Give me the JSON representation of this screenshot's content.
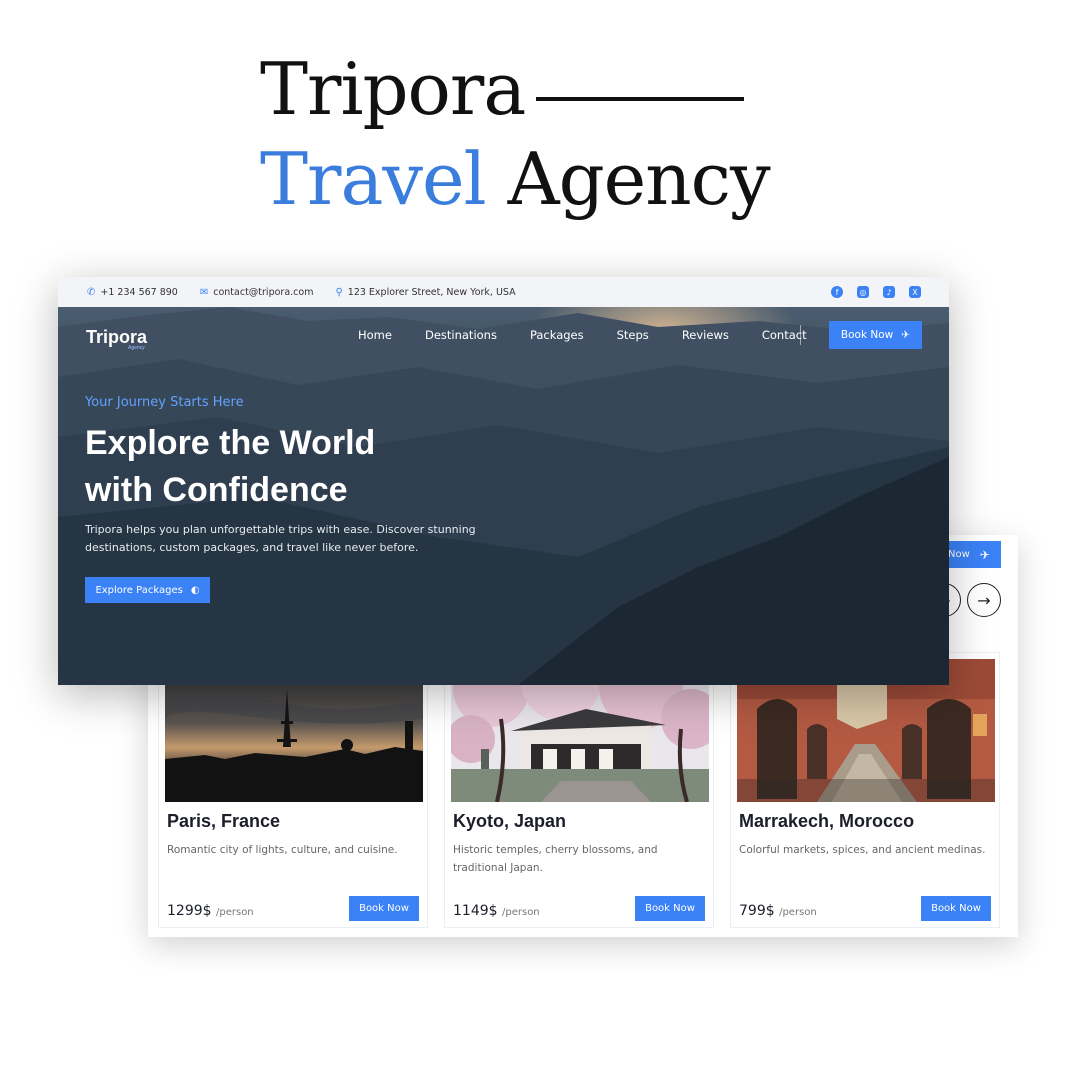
{
  "poster": {
    "title_line1": "Tripora",
    "title_word_accent": "Travel",
    "title_word_rest": "Agency"
  },
  "topbar": {
    "phone": "+1 234 567 890",
    "email": "contact@tripora.com",
    "address": "123 Explorer Street, New York, USA",
    "socials": [
      "facebook-icon",
      "instagram-icon",
      "tiktok-icon",
      "x-icon"
    ]
  },
  "nav": {
    "logo": "Tripora",
    "logo_sub": "Agency",
    "items": [
      "Home",
      "Destinations",
      "Packages",
      "Steps",
      "Reviews",
      "Contact"
    ],
    "book_label": "Book Now"
  },
  "hero": {
    "tagline": "Your Journey Starts Here",
    "headline_line1": "Explore the World",
    "headline_line2": "with Confidence",
    "lead": "Tripora helps you plan unforgettable trips with ease. Discover stunning destinations, custom packages, and travel like never before.",
    "cta": "Explore Packages"
  },
  "destinations_header": {
    "book_label_partial": "Now"
  },
  "destinations": [
    {
      "city": "Paris, France",
      "desc": "Romantic city of lights, culture, and cuisine.",
      "price": "1299$",
      "per": "/person",
      "book": "Book Now"
    },
    {
      "city": "Kyoto, Japan",
      "desc": "Historic temples, cherry blossoms, and traditional Japan.",
      "price": "1149$",
      "per": "/person",
      "book": "Book Now"
    },
    {
      "city": "Marrakech, Morocco",
      "desc": "Colorful markets, spices, and ancient medinas.",
      "price": "799$",
      "per": "/person",
      "book": "Book Now"
    }
  ],
  "colors": {
    "accent": "#3b82f6",
    "title_accent": "#3b7ddd",
    "hero_dark": "#1e2a36"
  }
}
